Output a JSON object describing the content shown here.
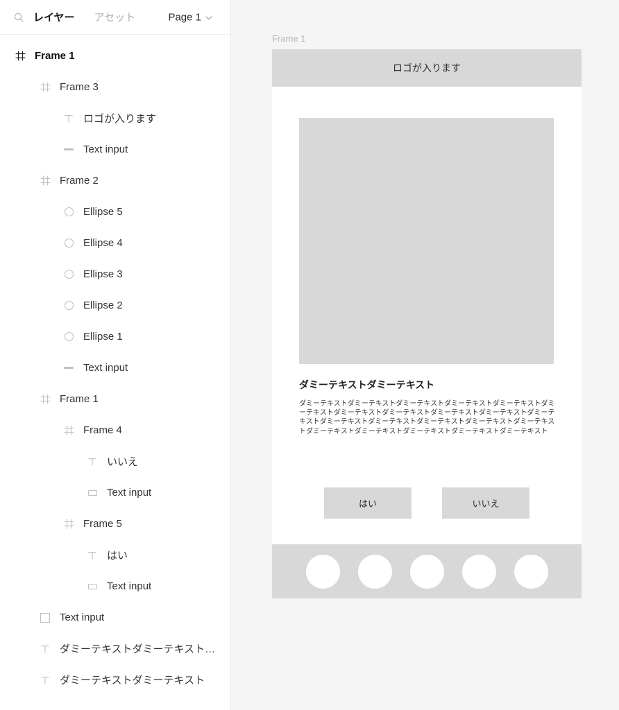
{
  "panel": {
    "search_icon": "search-icon",
    "tabs": [
      {
        "label": "レイヤー",
        "active": true
      },
      {
        "label": "アセット",
        "active": false
      }
    ],
    "page_selector": {
      "label": "Page 1",
      "chevron": "⌄"
    }
  },
  "layers": [
    {
      "label": "Frame 1",
      "icon": "frame-icon",
      "depth": 0,
      "root": true
    },
    {
      "label": "Frame 3",
      "icon": "frame-icon",
      "depth": 1,
      "root": false
    },
    {
      "label": "ロゴが入ります",
      "icon": "text-icon",
      "depth": 2,
      "root": false
    },
    {
      "label": "Text input",
      "icon": "dash-icon",
      "depth": 2,
      "root": false
    },
    {
      "label": "Frame 2",
      "icon": "frame-icon",
      "depth": 1,
      "root": false
    },
    {
      "label": "Ellipse 5",
      "icon": "ellipse-icon",
      "depth": 2,
      "root": false
    },
    {
      "label": "Ellipse 4",
      "icon": "ellipse-icon",
      "depth": 2,
      "root": false
    },
    {
      "label": "Ellipse 3",
      "icon": "ellipse-icon",
      "depth": 2,
      "root": false
    },
    {
      "label": "Ellipse 2",
      "icon": "ellipse-icon",
      "depth": 2,
      "root": false
    },
    {
      "label": "Ellipse 1",
      "icon": "ellipse-icon",
      "depth": 2,
      "root": false
    },
    {
      "label": "Text input",
      "icon": "dash-icon",
      "depth": 2,
      "root": false
    },
    {
      "label": "Frame 1",
      "icon": "frame-icon",
      "depth": 1,
      "root": false
    },
    {
      "label": "Frame 4",
      "icon": "frame-icon",
      "depth": 2,
      "root": false
    },
    {
      "label": "いいえ",
      "icon": "text-icon",
      "depth": 3,
      "root": false
    },
    {
      "label": "Text input",
      "icon": "rect-icon",
      "depth": 3,
      "root": false
    },
    {
      "label": "Frame 5",
      "icon": "frame-icon",
      "depth": 2,
      "root": false
    },
    {
      "label": "はい",
      "icon": "text-icon",
      "depth": 3,
      "root": false
    },
    {
      "label": "Text input",
      "icon": "rect-icon",
      "depth": 3,
      "root": false
    },
    {
      "label": "Text input",
      "icon": "square-icon",
      "depth": 1,
      "root": false
    },
    {
      "label": "ダミーテキストダミーテキスト…",
      "icon": "text-icon",
      "depth": 1,
      "root": false
    },
    {
      "label": "ダミーテキストダミーテキスト",
      "icon": "text-icon",
      "depth": 1,
      "root": false
    }
  ],
  "canvas": {
    "frame_label": "Frame 1",
    "artboard": {
      "header_text": "ロゴが入ります",
      "hero_image": "image-placeholder",
      "body_title": "ダミーテキストダミーテキスト",
      "body_text": "ダミーテキストダミーテキストダミーテキストダミーテキストダミーテキストダミーテキストダミーテキストダミーテキストダミーテキストダミーテキストダミーテキストダミーテキストダミーテキストダミーテキストダミーテキストダミーテキストダミーテキストダミーテキストダミーテキストダミーテキストダミーテキスト",
      "buttons": [
        {
          "label": "はい"
        },
        {
          "label": "いいえ"
        }
      ],
      "footer_dots": 5
    }
  },
  "colors": {
    "placeholder_gray": "#d8d8d8",
    "canvas_bg": "#f5f5f5",
    "panel_bg": "#ffffff",
    "divider": "#e6e6e6"
  }
}
